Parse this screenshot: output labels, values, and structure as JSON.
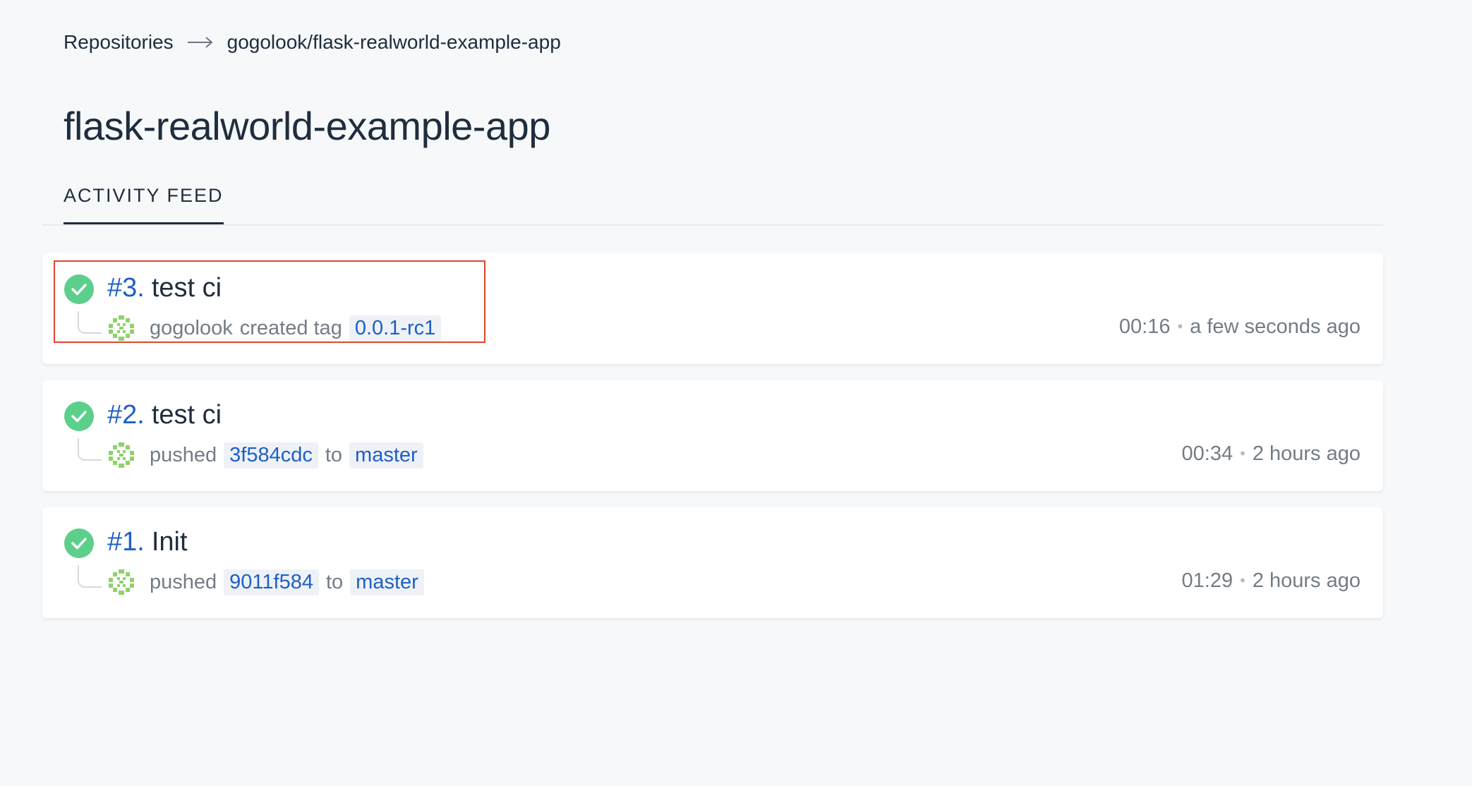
{
  "breadcrumb": {
    "root": "Repositories",
    "repo": "gogolook/flask-realworld-example-app"
  },
  "page": {
    "title": "flask-realworld-example-app"
  },
  "tabs": {
    "activity_feed": "ACTIVITY FEED"
  },
  "colors": {
    "success": "#5ccf8b",
    "link": "#1f5fc4",
    "highlight": "#e0452c"
  },
  "builds": [
    {
      "number": "#3.",
      "title": "test ci",
      "status_icon": "check-circle-icon",
      "meta": {
        "actor": "gogolook",
        "action": "created tag",
        "ref": "0.0.1-rc1"
      },
      "duration": "00:16",
      "time": "a few seconds ago"
    },
    {
      "number": "#2.",
      "title": "test ci",
      "status_icon": "check-circle-icon",
      "meta": {
        "action": "pushed",
        "commit": "3f584cdc",
        "connector": "to",
        "branch": "master"
      },
      "duration": "00:34",
      "time": "2 hours ago"
    },
    {
      "number": "#1.",
      "title": "Init",
      "status_icon": "check-circle-icon",
      "meta": {
        "action": "pushed",
        "commit": "9011f584",
        "connector": "to",
        "branch": "master"
      },
      "duration": "01:29",
      "time": "2 hours ago"
    }
  ],
  "separator": "•"
}
